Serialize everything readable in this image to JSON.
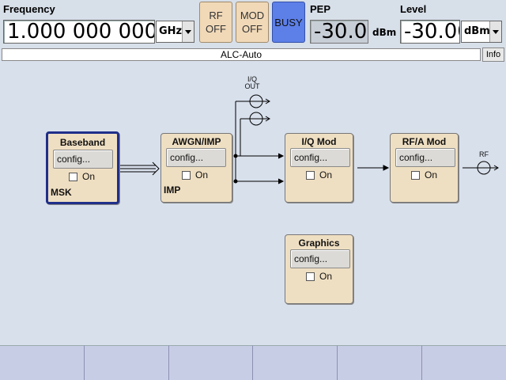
{
  "header": {
    "frequency_label": "Frequency",
    "frequency_value": "1.000 000 000 000",
    "frequency_unit": "GHz",
    "rf_button": "RF\nOFF",
    "rf_line1": "RF",
    "rf_line2": "OFF",
    "mod_line1": "MOD",
    "mod_line2": "OFF",
    "busy_label": "BUSY",
    "pep_label": "PEP",
    "pep_value": "-30.00",
    "pep_unit": "dBm",
    "level_label": "Level",
    "level_value": "-30.00",
    "level_unit": "dBm"
  },
  "status": {
    "text": "ALC-Auto",
    "info_label": "Info"
  },
  "blocks": {
    "baseband": {
      "title": "Baseband",
      "config": "config...",
      "on": "On",
      "sub": "MSK"
    },
    "awgn": {
      "title": "AWGN/IMP",
      "config": "config...",
      "on": "On",
      "sub": "IMP"
    },
    "iqmod": {
      "title": "I/Q Mod",
      "config": "config...",
      "on": "On"
    },
    "rfmod": {
      "title": "RF/A Mod",
      "config": "config...",
      "on": "On"
    },
    "graphics": {
      "title": "Graphics",
      "config": "config...",
      "on": "On"
    }
  },
  "connectors": {
    "iq_out_line1": "I/Q",
    "iq_out_line2": "OUT",
    "rf_out": "RF"
  },
  "colors": {
    "block_fill": "#efdfc2",
    "selected_border": "#1f2f8a",
    "busy": "#5c7fe8",
    "background": "#d8e0ec"
  }
}
